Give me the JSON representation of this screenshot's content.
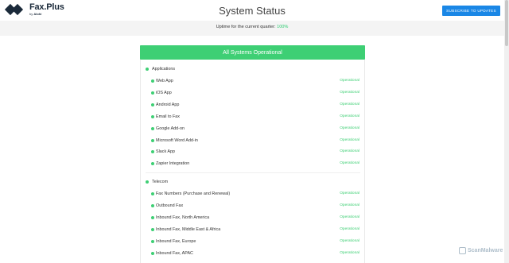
{
  "logo": {
    "name": "Fax.Plus",
    "by": "by",
    "company": "Alohi"
  },
  "title": "System Status",
  "subscribe_label": "SUBSCRIBE TO UPDATES",
  "uptime": {
    "label": "Uptime for the current quarter: ",
    "value": "100%"
  },
  "banner": "All Systems Operational",
  "groups": [
    {
      "name": "Applications",
      "items": [
        {
          "name": "Web App",
          "status": "Operational"
        },
        {
          "name": "iOS App",
          "status": "Operational"
        },
        {
          "name": "Android App",
          "status": "Operational"
        },
        {
          "name": "Email to Fax",
          "status": "Operational"
        },
        {
          "name": "Google Add-on",
          "status": "Operational"
        },
        {
          "name": "Microsoft Word Add-in",
          "status": "Operational"
        },
        {
          "name": "Slack App",
          "status": "Operational"
        },
        {
          "name": "Zapier Integration",
          "status": "Operational"
        }
      ]
    },
    {
      "name": "Telecom",
      "items": [
        {
          "name": "Fax Numbers (Purchase and Renewal)",
          "status": "Operational"
        },
        {
          "name": "Outbound Fax",
          "status": "Operational"
        },
        {
          "name": "Inbound Fax, North America",
          "status": "Operational"
        },
        {
          "name": "Inbound Fax, Middle East & Africa",
          "status": "Operational"
        },
        {
          "name": "Inbound Fax, Europe",
          "status": "Operational"
        },
        {
          "name": "Inbound Fax, APAC",
          "status": "Operational"
        }
      ]
    }
  ],
  "watermark": "ScanMalware",
  "colors": {
    "operational": "#3ecf74",
    "subscribe": "#1a87e6",
    "logo": "#1b2a3a"
  }
}
